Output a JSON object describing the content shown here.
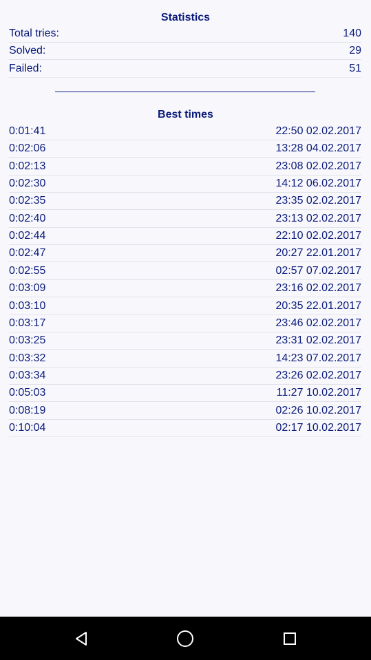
{
  "statistics": {
    "title": "Statistics",
    "rows": [
      {
        "label": "Total tries:",
        "value": "140"
      },
      {
        "label": "Solved:",
        "value": "29"
      },
      {
        "label": "Failed:",
        "value": "51"
      }
    ]
  },
  "best_times": {
    "title": "Best times",
    "rows": [
      {
        "time": "0:01:41",
        "date": "22:50 02.02.2017"
      },
      {
        "time": "0:02:06",
        "date": "13:28 04.02.2017"
      },
      {
        "time": "0:02:13",
        "date": "23:08 02.02.2017"
      },
      {
        "time": "0:02:30",
        "date": "14:12 06.02.2017"
      },
      {
        "time": "0:02:35",
        "date": "23:35 02.02.2017"
      },
      {
        "time": "0:02:40",
        "date": "23:13 02.02.2017"
      },
      {
        "time": "0:02:44",
        "date": "22:10 02.02.2017"
      },
      {
        "time": "0:02:47",
        "date": "20:27 22.01.2017"
      },
      {
        "time": "0:02:55",
        "date": "02:57 07.02.2017"
      },
      {
        "time": "0:03:09",
        "date": "23:16 02.02.2017"
      },
      {
        "time": "0:03:10",
        "date": "20:35 22.01.2017"
      },
      {
        "time": "0:03:17",
        "date": "23:46 02.02.2017"
      },
      {
        "time": "0:03:25",
        "date": "23:31 02.02.2017"
      },
      {
        "time": "0:03:32",
        "date": "14:23 07.02.2017"
      },
      {
        "time": "0:03:34",
        "date": "23:26 02.02.2017"
      },
      {
        "time": "0:05:03",
        "date": "11:27 10.02.2017"
      },
      {
        "time": "0:08:19",
        "date": "02:26 10.02.2017"
      },
      {
        "time": "0:10:04",
        "date": "02:17 10.02.2017"
      }
    ]
  },
  "navbar": {
    "back_icon": "back-triangle-icon",
    "home_icon": "home-circle-icon",
    "recents_icon": "recents-square-icon"
  },
  "colors": {
    "text": "#0a1a7a",
    "background": "#f8f8fc",
    "navbar": "#000000"
  }
}
